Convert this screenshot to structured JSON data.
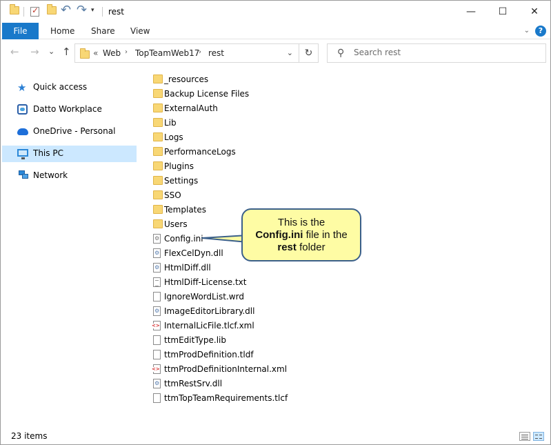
{
  "window": {
    "title": "rest",
    "controls": {
      "minimize": "—",
      "maximize": "☐",
      "close": "✕"
    }
  },
  "quick_access_toolbar": {
    "icons": [
      "folder-icon",
      "properties-check-icon",
      "new-folder-icon",
      "undo-icon",
      "redo-icon"
    ],
    "dropdown": "▾"
  },
  "ribbon": {
    "tabs": [
      {
        "label": "File",
        "active": true
      },
      {
        "label": "Home"
      },
      {
        "label": "Share"
      },
      {
        "label": "View"
      }
    ],
    "expand_glyph": "⌄",
    "help_glyph": "?"
  },
  "navigation": {
    "back": "←",
    "forward": "→",
    "recent": "⌄",
    "up": "↑"
  },
  "address_bar": {
    "overflow": "«",
    "separator": "›",
    "path": [
      "Web",
      "TopTeamWeb17",
      "rest"
    ],
    "dropdown": "⌄",
    "refresh": "↻"
  },
  "search": {
    "placeholder": "Search rest",
    "value": ""
  },
  "nav_pane": {
    "items": [
      {
        "label": "Quick access",
        "icon": "quick-access-star-icon"
      },
      {
        "label": "Datto Workplace",
        "icon": "datto-workplace-icon"
      },
      {
        "label": "OneDrive - Personal",
        "icon": "onedrive-cloud-icon"
      },
      {
        "label": "This PC",
        "icon": "this-pc-monitor-icon",
        "selected": true
      },
      {
        "label": "Network",
        "icon": "network-icon"
      }
    ]
  },
  "files": [
    {
      "name": "_resources",
      "type": "folder"
    },
    {
      "name": "Backup License Files",
      "type": "folder"
    },
    {
      "name": "ExternalAuth",
      "type": "folder"
    },
    {
      "name": "Lib",
      "type": "folder"
    },
    {
      "name": "Logs",
      "type": "folder"
    },
    {
      "name": "PerformanceLogs",
      "type": "folder"
    },
    {
      "name": "Plugins",
      "type": "folder"
    },
    {
      "name": "Settings",
      "type": "folder"
    },
    {
      "name": "SSO",
      "type": "folder"
    },
    {
      "name": "Templates",
      "type": "folder"
    },
    {
      "name": "Users",
      "type": "folder"
    },
    {
      "name": "Config.ini",
      "type": "ini"
    },
    {
      "name": "FlexCelDyn.dll",
      "type": "dll"
    },
    {
      "name": "HtmlDiff.dll",
      "type": "dll"
    },
    {
      "name": "HtmlDiff-License.txt",
      "type": "txt"
    },
    {
      "name": "IgnoreWordList.wrd",
      "type": "file"
    },
    {
      "name": "ImageEditorLibrary.dll",
      "type": "dll"
    },
    {
      "name": "InternalLicFile.tlcf.xml",
      "type": "xml"
    },
    {
      "name": "ttmEditType.lib",
      "type": "file"
    },
    {
      "name": "ttmProdDefinition.tldf",
      "type": "file"
    },
    {
      "name": "ttmProdDefinitionInternal.xml",
      "type": "xml"
    },
    {
      "name": "ttmRestSrv.dll",
      "type": "dll"
    },
    {
      "name": "ttmTopTeamRequirements.tlcf",
      "type": "file"
    }
  ],
  "callout": {
    "line1": "This is the",
    "file_bold": "Config.ini",
    "line2_rest": " file in the",
    "folder_bold": "rest",
    "line3_rest": " folder",
    "fill_color": "#fefca4",
    "border_color": "#3a5f8a"
  },
  "status_bar": {
    "item_count": "23 items",
    "views": [
      "details-view-icon",
      "large-icons-view-icon"
    ]
  },
  "colors": {
    "accent": "#1979ca",
    "selection": "#cce8ff",
    "folder": "#f8d775"
  }
}
